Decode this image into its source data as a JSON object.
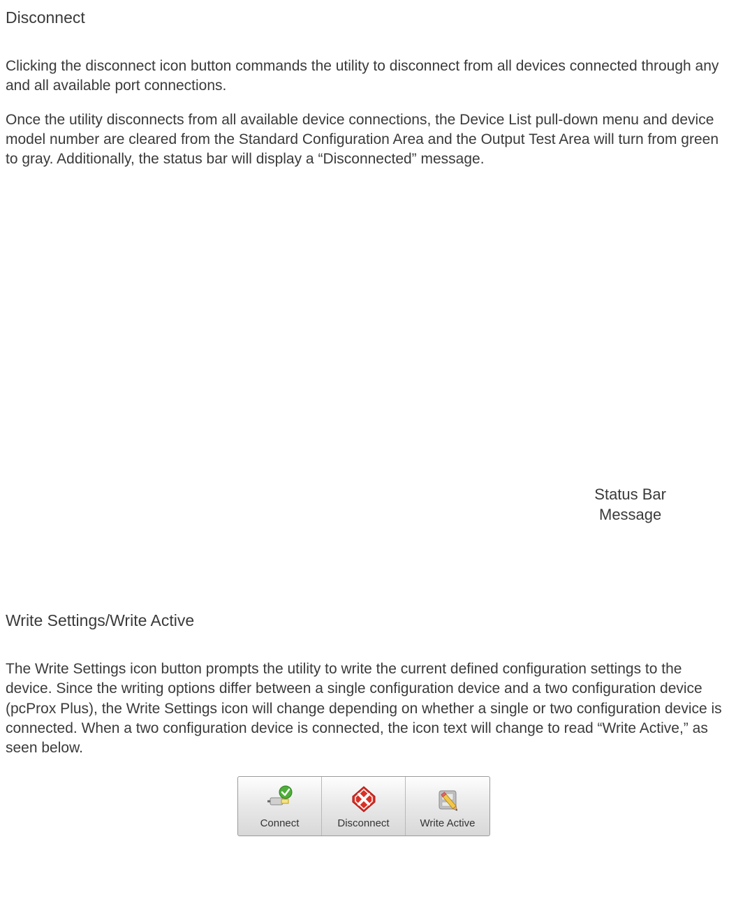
{
  "section1": {
    "heading": "Disconnect",
    "para1": "Clicking the disconnect icon button commands the utility to disconnect from all devices connected through any and all available port connections.",
    "para2": "Once the utility disconnects from all available device connections, the Device List pull-down menu and device model number are cleared from the Standard Configuration Area and the Output Test Area will turn from green to gray. Additionally, the status bar will display a “Disconnected”  message."
  },
  "statusBarLabel": {
    "line1": "Status Bar",
    "line2": "Message"
  },
  "section2": {
    "heading": "Write Settings/Write Active",
    "para1": "The Write Settings icon button prompts the utility to write the current defined configuration settings to the device. Since the writing options differ between a single configuration device and a two configuration device (pcProx Plus), the Write Settings icon will change depending on whether a single or two configuration device is connected. When a two configuration device is connected, the icon text will change to read “Write Active,” as seen below."
  },
  "toolbar": {
    "connect": "Connect",
    "disconnect": "Disconnect",
    "writeActive": "Write Active"
  }
}
